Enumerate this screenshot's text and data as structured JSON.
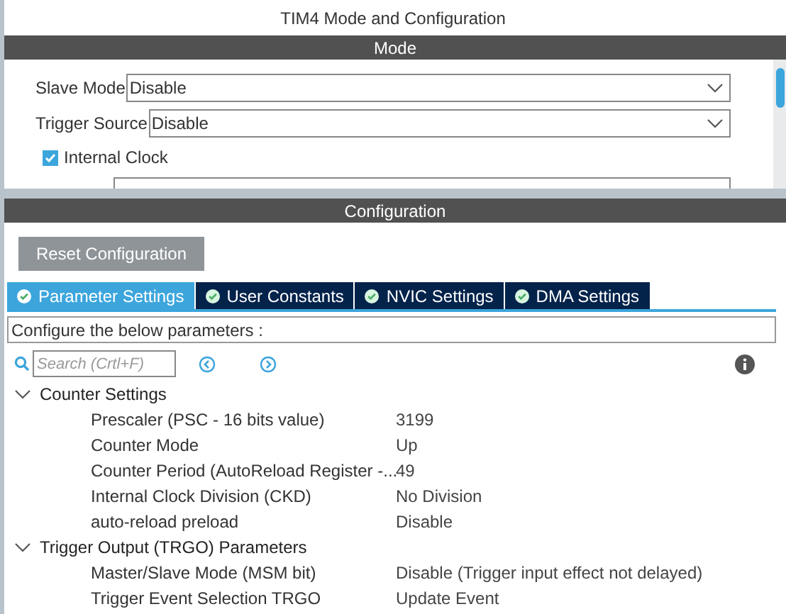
{
  "window": {
    "title": "TIM4 Mode and Configuration"
  },
  "mode": {
    "header": "Mode",
    "fields": [
      {
        "kind": "select",
        "label": "Slave Mode",
        "value": "Disable"
      },
      {
        "kind": "select",
        "label": "Trigger Source",
        "value": "Disable"
      },
      {
        "kind": "checkbox",
        "label": "Internal Clock",
        "checked": true
      },
      {
        "kind": "cut"
      }
    ]
  },
  "configuration": {
    "header": "Configuration",
    "reset_button": "Reset Configuration",
    "tabs": [
      {
        "label": "Parameter Settings",
        "selected": true
      },
      {
        "label": "User Constants",
        "selected": false
      },
      {
        "label": "NVIC Settings",
        "selected": false
      },
      {
        "label": "DMA Settings",
        "selected": false
      }
    ],
    "hint": "Configure the below parameters :",
    "search": {
      "placeholder": "Search (Crtl+F)"
    },
    "groups": [
      {
        "label": "Counter Settings",
        "expanded": true,
        "children": [
          {
            "name": "Prescaler (PSC - 16 bits value)",
            "value": "3199"
          },
          {
            "name": "Counter Mode",
            "value": "Up"
          },
          {
            "name": "Counter Period (AutoReload Register -...",
            "value": "49"
          },
          {
            "name": "Internal Clock Division (CKD)",
            "value": "No Division"
          },
          {
            "name": "auto-reload preload",
            "value": "Disable"
          }
        ]
      },
      {
        "label": "Trigger Output (TRGO) Parameters",
        "expanded": true,
        "children": [
          {
            "name": "Master/Slave Mode (MSM bit)",
            "value": "Disable (Trigger input effect not delayed)"
          },
          {
            "name": "Trigger Event Selection TRGO",
            "value": "Update Event"
          }
        ]
      }
    ]
  }
}
